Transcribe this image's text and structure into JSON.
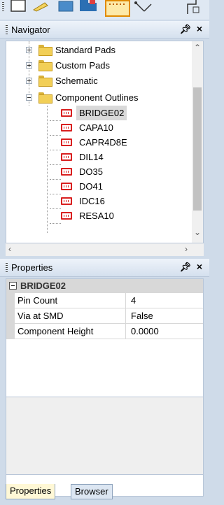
{
  "toolbar": {
    "icons": [
      "select-box-icon",
      "pencil-icon",
      "chip-icon",
      "place-component-icon",
      "grid-icon",
      "route-icon"
    ]
  },
  "navigator": {
    "title": "Navigator",
    "pin_glyph": "p",
    "close_glyph": "×",
    "folders": [
      {
        "label": "Standard Pads",
        "expanded": false
      },
      {
        "label": "Custom Pads",
        "expanded": false
      },
      {
        "label": "Schematic",
        "expanded": false
      },
      {
        "label": "Component Outlines",
        "expanded": true
      }
    ],
    "components": [
      "BRIDGE02",
      "CAPA10",
      "CAPR4D8E",
      "DIL14",
      "DO35",
      "DO41",
      "IDC16",
      "RESA10"
    ],
    "selected": "BRIDGE02"
  },
  "properties": {
    "title": "Properties",
    "group": "BRIDGE02",
    "rows": [
      {
        "name": "Pin Count",
        "value": "4"
      },
      {
        "name": "Via at SMD",
        "value": "False"
      },
      {
        "name": "Component Height",
        "value": "0.0000"
      }
    ]
  },
  "tabs": {
    "properties": "Properties",
    "browser": "Browser"
  }
}
